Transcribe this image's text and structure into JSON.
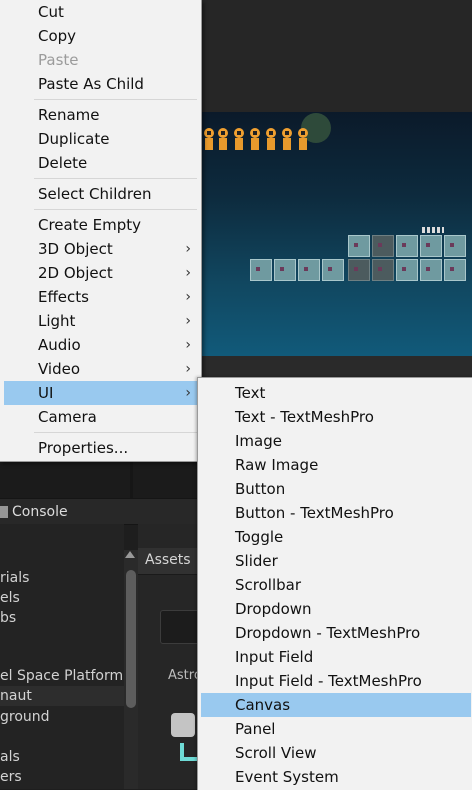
{
  "context_menu": {
    "items": [
      {
        "label": "Cut"
      },
      {
        "label": "Copy"
      },
      {
        "label": "Paste"
      },
      {
        "label": "Paste As Child"
      },
      {
        "label": "Rename"
      },
      {
        "label": "Duplicate"
      },
      {
        "label": "Delete"
      },
      {
        "label": "Select Children"
      },
      {
        "label": "Create Empty"
      },
      {
        "label": "3D Object",
        "submenu": true
      },
      {
        "label": "2D Object",
        "submenu": true
      },
      {
        "label": "Effects",
        "submenu": true
      },
      {
        "label": "Light",
        "submenu": true
      },
      {
        "label": "Audio",
        "submenu": true
      },
      {
        "label": "Video",
        "submenu": true
      },
      {
        "label": "UI",
        "submenu": true,
        "highlighted": true
      },
      {
        "label": "Camera"
      },
      {
        "label": "Properties..."
      }
    ],
    "submenu_arrow": "›"
  },
  "ui_submenu": {
    "items": [
      {
        "label": "Text"
      },
      {
        "label": "Text - TextMeshPro"
      },
      {
        "label": "Image"
      },
      {
        "label": "Raw Image"
      },
      {
        "label": "Button"
      },
      {
        "label": "Button - TextMeshPro"
      },
      {
        "label": "Toggle"
      },
      {
        "label": "Slider"
      },
      {
        "label": "Scrollbar"
      },
      {
        "label": "Dropdown"
      },
      {
        "label": "Dropdown - TextMeshPro"
      },
      {
        "label": "Input Field"
      },
      {
        "label": "Input Field - TextMeshPro"
      },
      {
        "label": "Canvas",
        "highlighted": true
      },
      {
        "label": "Panel"
      },
      {
        "label": "Scroll View"
      },
      {
        "label": "Event System"
      }
    ]
  },
  "console_tab": {
    "label": "Console"
  },
  "project_tree": {
    "items": [
      "rials",
      "els",
      "bs",
      "",
      "el Space Platform",
      "naut",
      "ground",
      "",
      "als",
      "ers"
    ]
  },
  "assets": {
    "breadcrumb": "Assets",
    "asset_name": "Astro"
  },
  "colors": {
    "menu_bg": "#f2f2f2",
    "highlight": "#99c9ef",
    "disabled_text": "#9b9b9b"
  }
}
